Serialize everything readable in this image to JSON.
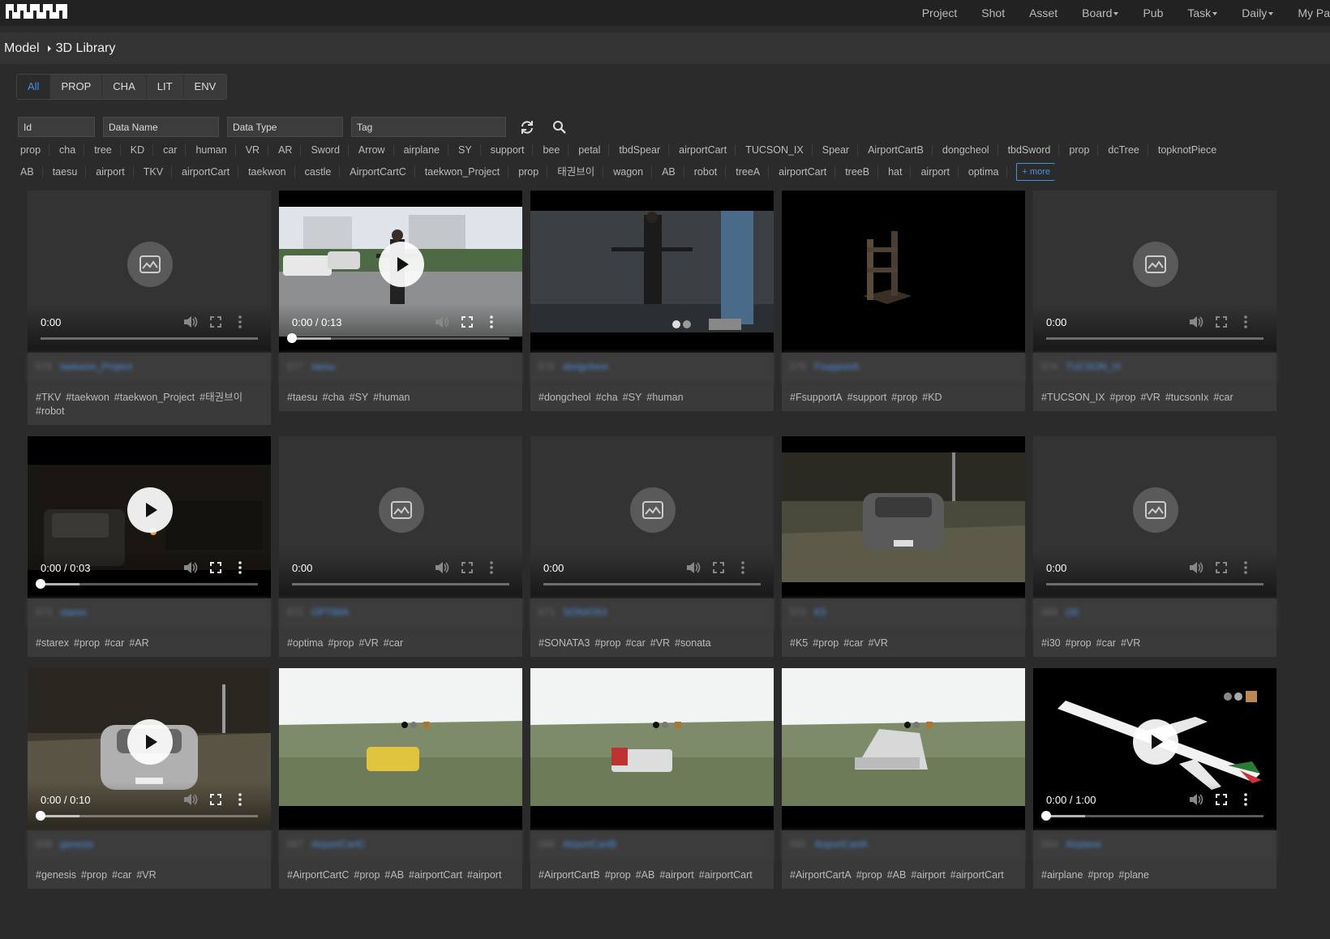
{
  "nav": {
    "items": [
      {
        "label": "Project",
        "dropdown": false
      },
      {
        "label": "Shot",
        "dropdown": false
      },
      {
        "label": "Asset",
        "dropdown": false
      },
      {
        "label": "Board",
        "dropdown": true
      },
      {
        "label": "Pub",
        "dropdown": false
      },
      {
        "label": "Task",
        "dropdown": true
      },
      {
        "label": "Daily",
        "dropdown": true
      },
      {
        "label": "My Pa",
        "dropdown": false
      }
    ]
  },
  "breadcrumb": {
    "root": "Model",
    "current": "3D Library"
  },
  "tabs": [
    "All",
    "PROP",
    "CHA",
    "LIT",
    "ENV"
  ],
  "filters": {
    "id_placeholder": "Id",
    "name_placeholder": "Data Name",
    "type_placeholder": "Data Type",
    "tag_placeholder": "Tag"
  },
  "tag_rows": [
    [
      "prop",
      "cha",
      "tree",
      "KD",
      "car",
      "human",
      "VR",
      "AR",
      "Sword",
      "Arrow",
      "airplane",
      "SY",
      "support",
      "bee",
      "petal",
      "tbdSpear",
      "airportCart",
      "TUCSON_IX",
      "Spear",
      "AirportCartB",
      "dongcheol",
      "tbdSword",
      "prop",
      "dcTree",
      "topknotPiece"
    ],
    [
      "AB",
      "taesu",
      "airport",
      "TKV",
      "airportCart",
      "taekwon",
      "castle",
      "AirportCartC",
      "taekwon_Project",
      "prop",
      "태권브이",
      "wagon",
      "AB",
      "robot",
      "treeA",
      "airportCart",
      "treeB",
      "hat",
      "airport",
      "optima"
    ]
  ],
  "more_label": "+ more",
  "colors": {
    "accent": "#4a90e2",
    "background": "#2b2b2b",
    "card": "#3a3a3a"
  },
  "cards": [
    {
      "num": "578",
      "name": "taekwon_Project",
      "tags": [
        "#TKV",
        "#taekwon",
        "#taekwon_Project",
        "#태권브이",
        "#robot"
      ],
      "time": "0:00",
      "state": "empty",
      "progress": null
    },
    {
      "num": "577",
      "name": "taesu",
      "tags": [
        "#taesu",
        "#cha",
        "#SY",
        "#human"
      ],
      "time": "0:00 / 0:13",
      "state": "video",
      "progress": 0.0
    },
    {
      "num": "576",
      "name": "dongcheol",
      "tags": [
        "#dongcheol",
        "#cha",
        "#SY",
        "#human"
      ],
      "time": "",
      "state": "image",
      "progress": null
    },
    {
      "num": "575",
      "name": "FsupportA",
      "tags": [
        "#FsupportA",
        "#support",
        "#prop",
        "#KD"
      ],
      "time": "",
      "state": "image",
      "progress": null
    },
    {
      "num": "574",
      "name": "TUCSON_IX",
      "tags": [
        "#TUCSON_IX",
        "#prop",
        "#VR",
        "#tucsonIx",
        "#car"
      ],
      "time": "0:00",
      "state": "empty",
      "progress": null
    },
    {
      "num": "573",
      "name": "starex",
      "tags": [
        "#starex",
        "#prop",
        "#car",
        "#AR"
      ],
      "time": "0:00 / 0:03",
      "state": "video",
      "progress": 0.0
    },
    {
      "num": "572",
      "name": "OPTIMA",
      "tags": [
        "#optima",
        "#prop",
        "#VR",
        "#car"
      ],
      "time": "0:00",
      "state": "empty",
      "progress": null
    },
    {
      "num": "571",
      "name": "SONATA3",
      "tags": [
        "#SONATA3",
        "#prop",
        "#car",
        "#VR",
        "#sonata"
      ],
      "time": "0:00",
      "state": "empty",
      "progress": null
    },
    {
      "num": "570",
      "name": "K5",
      "tags": [
        "#K5",
        "#prop",
        "#car",
        "#VR"
      ],
      "time": "",
      "state": "image",
      "progress": null
    },
    {
      "num": "569",
      "name": "i30",
      "tags": [
        "#i30",
        "#prop",
        "#car",
        "#VR"
      ],
      "time": "0:00",
      "state": "empty",
      "progress": null
    },
    {
      "num": "568",
      "name": "genesis",
      "tags": [
        "#genesis",
        "#prop",
        "#car",
        "#VR"
      ],
      "time": "0:00 / 0:10",
      "state": "video",
      "progress": 0.0
    },
    {
      "num": "567",
      "name": "AirportCartC",
      "tags": [
        "#AirportCartC",
        "#prop",
        "#AB",
        "#airportCart",
        "#airport"
      ],
      "time": "",
      "state": "image",
      "progress": null
    },
    {
      "num": "566",
      "name": "AirportCartB",
      "tags": [
        "#AirportCartB",
        "#prop",
        "#AB",
        "#airport",
        "#airportCart"
      ],
      "time": "",
      "state": "image",
      "progress": null
    },
    {
      "num": "565",
      "name": "AirportCartA",
      "tags": [
        "#AirportCartA",
        "#prop",
        "#AB",
        "#airport",
        "#airportCart"
      ],
      "time": "",
      "state": "image",
      "progress": null
    },
    {
      "num": "564",
      "name": "Airplane",
      "tags": [
        "#airplane",
        "#prop",
        "#plane"
      ],
      "time": "0:00 / 1:00",
      "state": "video",
      "progress": 0.0
    }
  ]
}
